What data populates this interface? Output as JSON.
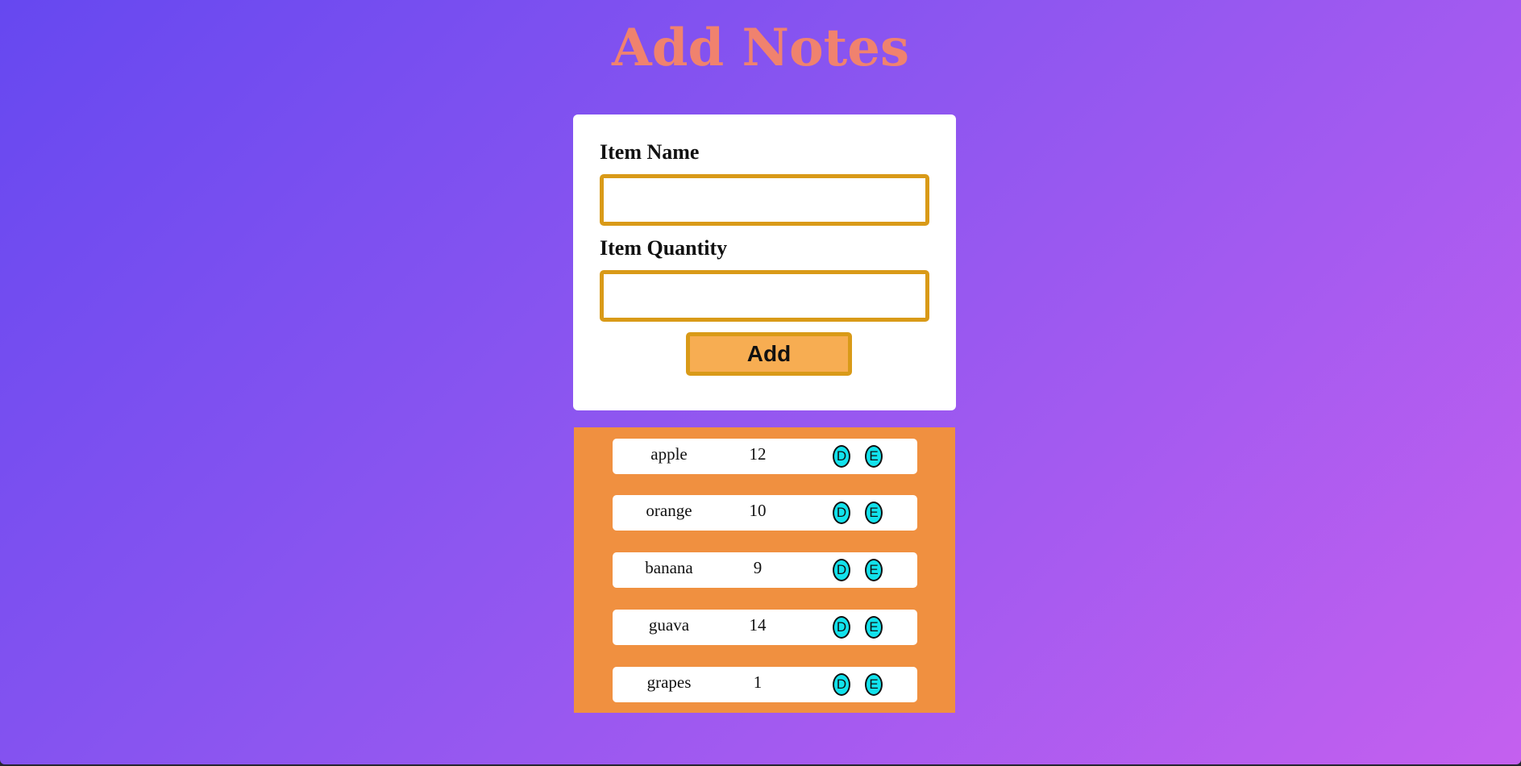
{
  "page": {
    "title": "Add Notes"
  },
  "form": {
    "name_label": "Item Name",
    "name_value": "",
    "quantity_label": "Item Quantity",
    "quantity_value": "",
    "add_label": "Add"
  },
  "items": [
    {
      "name": "apple",
      "quantity": "12",
      "delete_label": "D",
      "edit_label": "E"
    },
    {
      "name": "orange",
      "quantity": "10",
      "delete_label": "D",
      "edit_label": "E"
    },
    {
      "name": "banana",
      "quantity": "9",
      "delete_label": "D",
      "edit_label": "E"
    },
    {
      "name": "guava",
      "quantity": "14",
      "delete_label": "D",
      "edit_label": "E"
    },
    {
      "name": "grapes",
      "quantity": "1",
      "delete_label": "D",
      "edit_label": "E"
    }
  ],
  "colors": {
    "background_start": "#6648f0",
    "background_end": "#c460ef",
    "title": "#f0826e",
    "input_border": "#d99a18",
    "add_button": "#f7ad52",
    "list_panel": "#f09040",
    "row_button": "#12e2ec"
  }
}
